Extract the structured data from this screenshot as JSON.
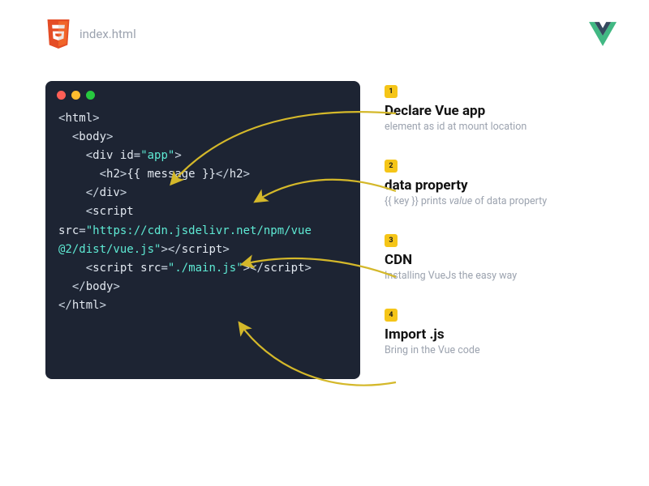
{
  "header": {
    "filename": "index.html"
  },
  "code": {
    "lines": [
      {
        "indent": 0,
        "kind": "open",
        "tag": "html"
      },
      {
        "indent": 1,
        "kind": "open",
        "tag": "body"
      },
      {
        "indent": 2,
        "kind": "open",
        "tag": "div",
        "attr": "id",
        "value": "app"
      },
      {
        "indent": 3,
        "kind": "wrap",
        "tag": "h2",
        "inner_mustache": "{{ message }}"
      },
      {
        "indent": 2,
        "kind": "close",
        "tag": "div"
      },
      {
        "indent": 2,
        "kind": "open_noclose",
        "tag": "script"
      },
      {
        "indent": 0,
        "kind": "attr_line",
        "attr": "src",
        "value": "https://cdn.jsdelivr.net/npm/vue"
      },
      {
        "indent": 0,
        "kind": "attr_end",
        "value": "@2/dist/vue.js",
        "close_tag": "script"
      },
      {
        "indent": 2,
        "kind": "script_src",
        "tag": "script",
        "attr": "src",
        "value": "./main.js"
      },
      {
        "indent": 1,
        "kind": "close",
        "tag": "body"
      },
      {
        "indent": 0,
        "kind": "close",
        "tag": "html"
      }
    ]
  },
  "annotations": [
    {
      "num": "1",
      "title": "Declare Vue app",
      "sub": "element as id at mount location"
    },
    {
      "num": "2",
      "title": "data property",
      "sub_html": "{{ key }} prints <em>value</em> of data property"
    },
    {
      "num": "3",
      "title": "CDN",
      "sub": "Installing VueJs the easy way"
    },
    {
      "num": "4",
      "title": "Import .js",
      "sub": "Bring in the Vue code"
    }
  ],
  "colors": {
    "accent": "#f5c518",
    "code_bg": "#1d2433",
    "string": "#5eead4",
    "html5": "#e44d26",
    "vue_dark": "#35495e",
    "vue_green": "#41b883"
  }
}
